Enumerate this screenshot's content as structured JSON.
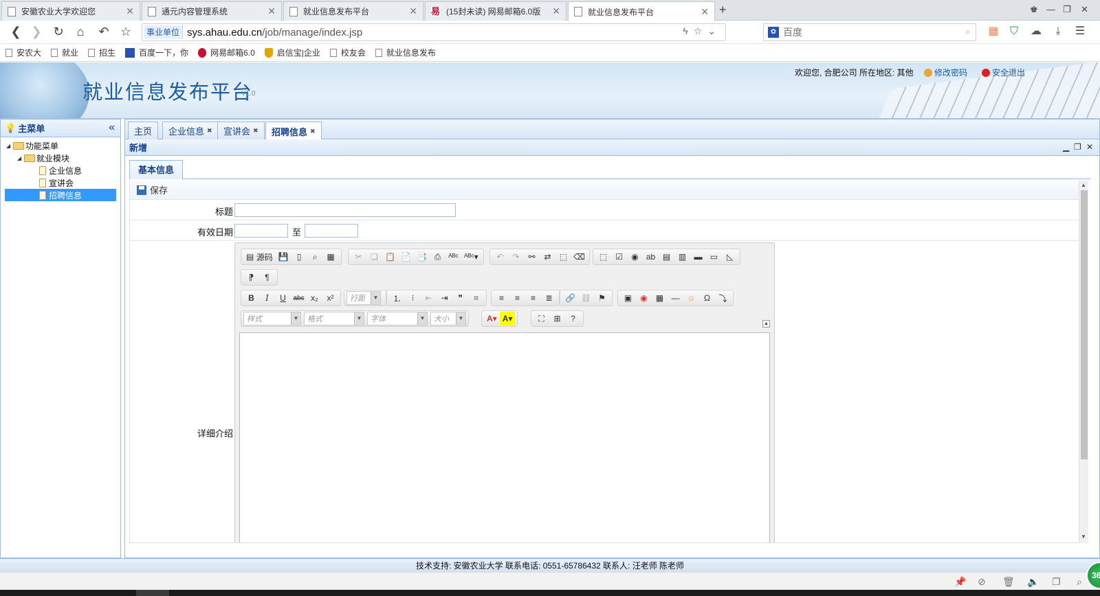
{
  "browser": {
    "tabs": [
      {
        "label": "安徽农业大学欢迎您",
        "active": false
      },
      {
        "label": "通元内容管理系统",
        "active": false
      },
      {
        "label": "就业信息发布平台",
        "active": false
      },
      {
        "label": "(15封未读) 网易邮箱6.0版",
        "active": false
      },
      {
        "label": "就业信息发布平台",
        "active": true
      }
    ],
    "address": {
      "badge": "事业单位",
      "host": "sys.ahau.edu.cn",
      "path": "/job/manage/index.jsp"
    },
    "search": {
      "placeholder": "百度"
    },
    "bookmarks": [
      "安农大",
      "就业",
      "招生",
      "百度一下，你",
      "网易邮箱6.0",
      "启信宝|企业",
      "校友会",
      "就业信息发布"
    ]
  },
  "app": {
    "title": "就业信息发布平台",
    "version": "V1.0",
    "user_info": "欢迎您, 合肥公司  所在地区: 其他",
    "change_password": "修改密码",
    "logout": "安全退出"
  },
  "left_menu": {
    "title": "主菜单",
    "collapse_icon": "«",
    "tree": [
      {
        "label": "功能菜单",
        "type": "folder",
        "level": 0
      },
      {
        "label": "就业模块",
        "type": "folder",
        "level": 1
      },
      {
        "label": "企业信息",
        "type": "file",
        "level": 2
      },
      {
        "label": "宣讲会",
        "type": "file",
        "level": 2
      },
      {
        "label": "招聘信息",
        "type": "file",
        "level": 2,
        "selected": true
      }
    ]
  },
  "page_tabs": [
    {
      "label": "主页",
      "closable": false
    },
    {
      "label": "企业信息",
      "closable": true
    },
    {
      "label": "宣讲会",
      "closable": true
    },
    {
      "label": "招聘信息",
      "closable": true,
      "active": true
    }
  ],
  "panel": {
    "title": "新增",
    "subtab": "基本信息",
    "save_label": "保存",
    "fields": {
      "title_label": "标题",
      "title_value": "",
      "date_label": "有效日期",
      "date_from": "",
      "date_sep": "至",
      "date_to": "",
      "detail_label": "详细介绍"
    }
  },
  "editor": {
    "source_label": "源码",
    "combos": [
      "行距",
      "样式",
      "格式",
      "字体",
      "大小"
    ]
  },
  "footer": {
    "text": "技术支持: 安徽农业大学  联系电话: 0551-65786432  联系人: 汪老师 陈老师"
  },
  "badge360": "36",
  "colors": {
    "accent": "#15428b",
    "panel_border": "#99bbe8",
    "selected_row": "#3399ff",
    "title_blue": "#1d5c9e"
  }
}
